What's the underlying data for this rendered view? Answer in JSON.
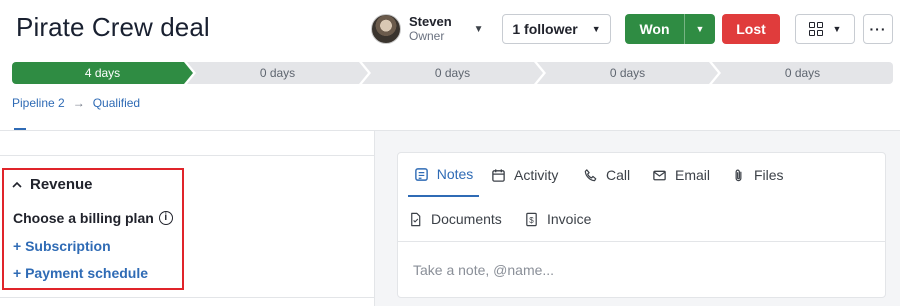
{
  "deal": {
    "title": "Pirate Crew deal"
  },
  "owner": {
    "name": "Steven",
    "role": "Owner"
  },
  "header": {
    "follower_label": "1 follower",
    "won_label": "Won",
    "lost_label": "Lost",
    "more_label": "···"
  },
  "pipeline": {
    "stages": [
      {
        "label": "4 days",
        "active": true
      },
      {
        "label": "0 days",
        "active": false
      },
      {
        "label": "0 days",
        "active": false
      },
      {
        "label": "0 days",
        "active": false
      },
      {
        "label": "0 days",
        "active": false
      }
    ]
  },
  "breadcrumb": {
    "pipeline": "Pipeline 2",
    "stage": "Qualified"
  },
  "tabs": [
    {
      "label": "Notes",
      "icon": "notes-icon",
      "active": true
    },
    {
      "label": "Activity",
      "icon": "calendar-icon"
    },
    {
      "label": "Call",
      "icon": "phone-icon"
    },
    {
      "label": "Email",
      "icon": "envelope-icon"
    },
    {
      "label": "Files",
      "icon": "paperclip-icon"
    },
    {
      "label": "Documents",
      "icon": "document-icon"
    },
    {
      "label": "Invoice",
      "icon": "dollar-document-icon"
    }
  ],
  "note": {
    "placeholder": "Take a note, @name..."
  },
  "revenue": {
    "title": "Revenue",
    "billing_label": "Choose a billing plan",
    "links": [
      "+ Subscription",
      "+ Payment schedule"
    ]
  },
  "colors": {
    "accent": "#2f6bb5",
    "won": "#2f8c43",
    "lost": "#e03c3c",
    "highlight": "#e0242a"
  }
}
